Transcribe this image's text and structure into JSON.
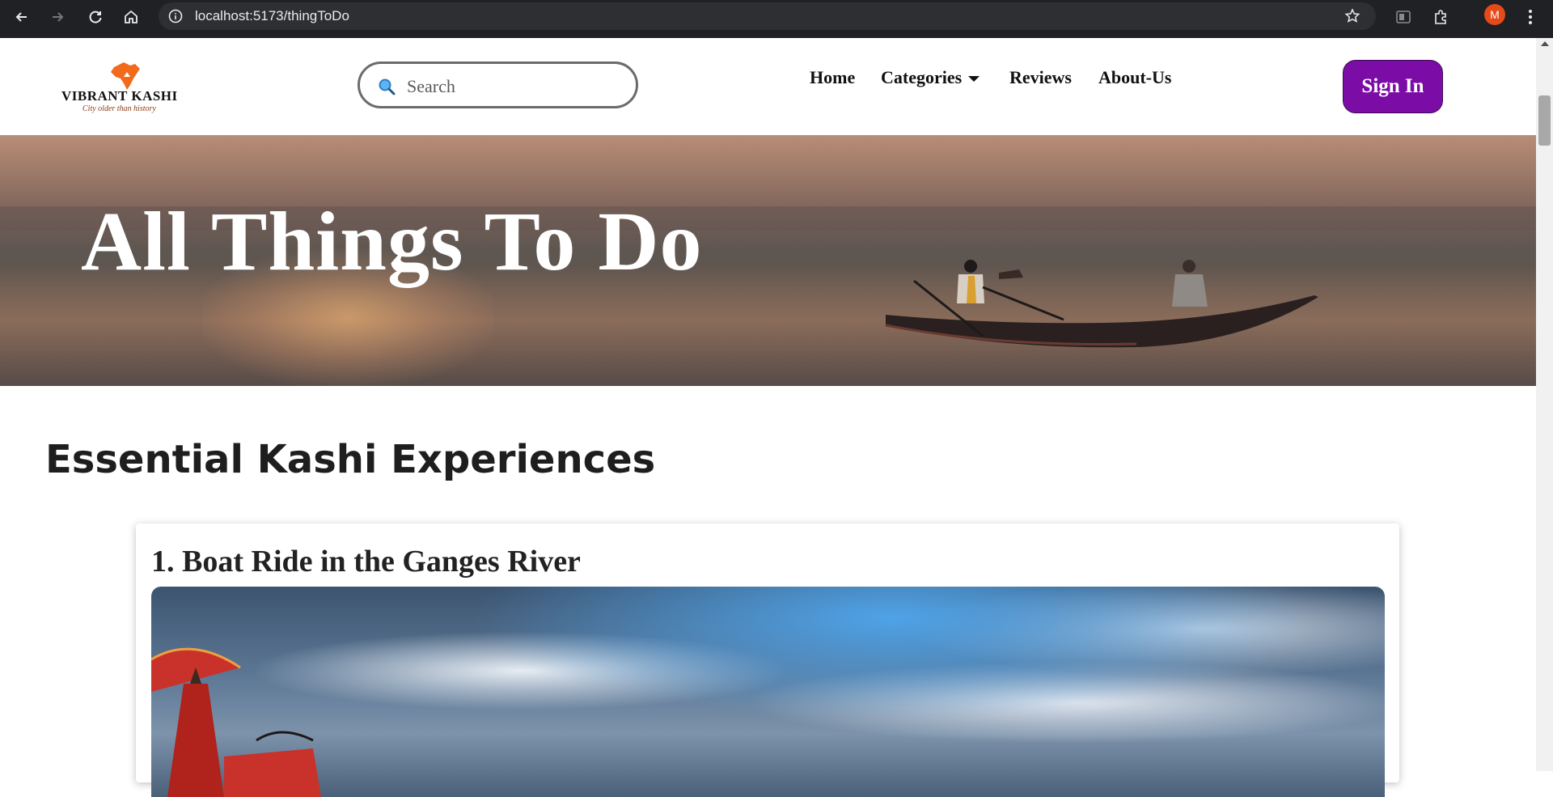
{
  "browser": {
    "url": "localhost:5173/thingToDo",
    "profile_initial": "M"
  },
  "header": {
    "logo": {
      "name": "VIBRANT KASHI",
      "tagline": "City older than history"
    },
    "search": {
      "placeholder": "Search",
      "value": ""
    },
    "nav": [
      {
        "label": "Home"
      },
      {
        "label": "Categories",
        "has_dropdown": true
      },
      {
        "label": "Reviews"
      },
      {
        "label": "About-Us"
      }
    ],
    "signin_label": "Sign In"
  },
  "hero": {
    "title": "All Things To Do"
  },
  "section": {
    "title": "Essential Kashi Experiences"
  },
  "experiences": [
    {
      "title": "1. Boat Ride in the Ganges River"
    }
  ],
  "colors": {
    "brand_purple": "#7b0da6",
    "logo_orange": "#f26a1b",
    "text_dark": "#1e1e1e"
  }
}
